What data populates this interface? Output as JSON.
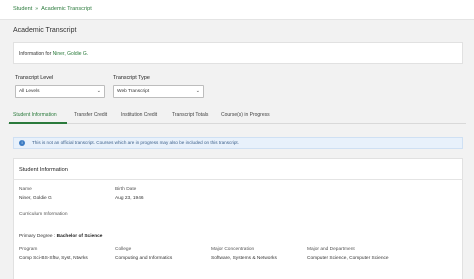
{
  "breadcrumb": {
    "home": "Student",
    "separator": "»",
    "current": "Academic Transcript"
  },
  "page": {
    "title": "Academic Transcript"
  },
  "info": {
    "prefix": "Information for",
    "student_name": "Niner, Goldie G."
  },
  "filters": {
    "level_label": "Transcript Level",
    "level_value": "All Levels",
    "type_label": "Transcript Type",
    "type_value": "Web Transcript"
  },
  "tabs": [
    {
      "label": "Student Information",
      "active": true
    },
    {
      "label": "Transfer Credit"
    },
    {
      "label": "Institution Credit"
    },
    {
      "label": "Transcript Totals"
    },
    {
      "label": "Course(s) in Progress"
    }
  ],
  "notice": {
    "icon": "info-icon",
    "text": "This is not an official transcript. Courses which are in progress may also be included on this transcript."
  },
  "student_info": {
    "section_title": "Student Information",
    "name_label": "Name",
    "name_value": "Niner, Goldie G",
    "birth_label": "Birth Date",
    "birth_value": "Aug 23, 1946",
    "curriculum_label": "Curriculum Information",
    "primary_degree_label": "Primary Degree :",
    "primary_degree_value": "Bachelor of Science",
    "program_label": "Program",
    "program_value": "Comp Sci-BS-Sftw, Syst, Ntwrks",
    "college_label": "College",
    "college_value": "Computing and Informatics",
    "major_conc_label": "Major Concentration",
    "major_conc_value": "Software, Systems & Networks",
    "major_dept_label": "Major and Department",
    "major_dept_value": "Computer Science, Computer Science"
  },
  "colors": {
    "accent": "#2a7a3b",
    "notice_bg": "#e8f1fb",
    "info_icon": "#3b7cc4"
  }
}
